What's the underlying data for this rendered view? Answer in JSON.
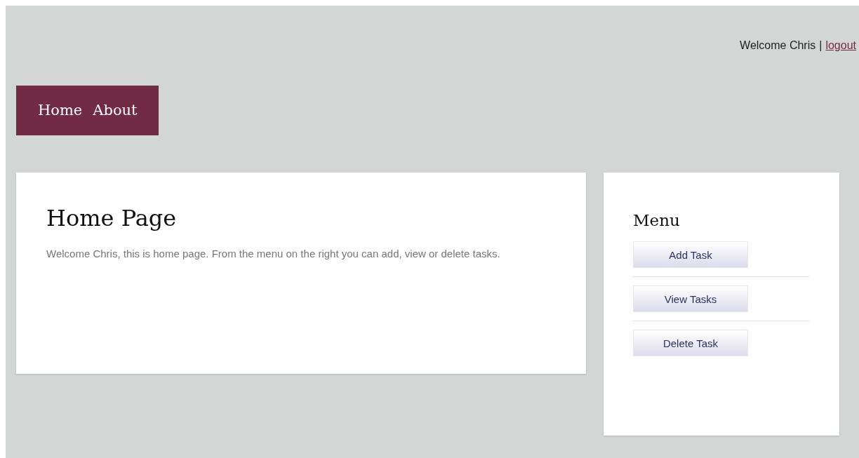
{
  "user_bar": {
    "greeting": "Welcome Chris",
    "separator": "|",
    "link": "logout"
  },
  "nav": {
    "items": [
      "Home",
      "About"
    ]
  },
  "content": {
    "title": "Home Page",
    "text": "Welcome Chris, this is home page. From the menu on the right you can add, view or delete tasks."
  },
  "sidebar": {
    "title": "Menu",
    "buttons": [
      "Add Task",
      "View Tasks",
      "Delete Task"
    ]
  }
}
